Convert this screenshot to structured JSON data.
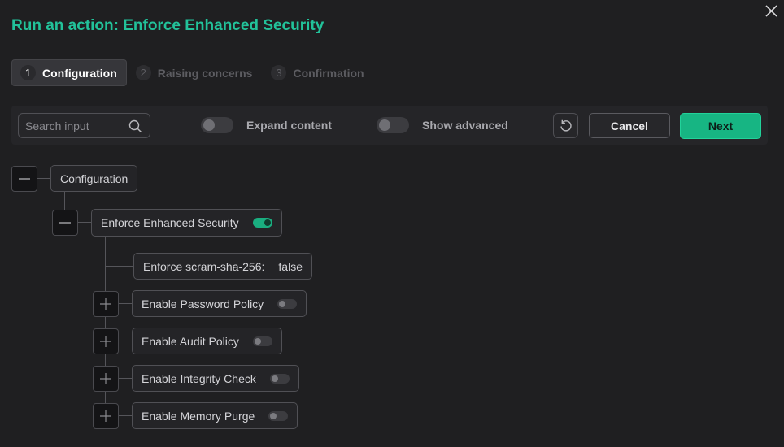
{
  "dialog": {
    "title": "Run an action: Enforce Enhanced Security"
  },
  "steps": [
    {
      "number": "1",
      "label": "Configuration",
      "active": true
    },
    {
      "number": "2",
      "label": "Raising concerns",
      "active": false
    },
    {
      "number": "3",
      "label": "Confirmation",
      "active": false
    }
  ],
  "toolbar": {
    "search_placeholder": "Search input",
    "expand_content_label": "Expand content",
    "expand_content_on": false,
    "show_advanced_label": "Show advanced",
    "show_advanced_on": false,
    "cancel_label": "Cancel",
    "next_label": "Next"
  },
  "tree": {
    "root": {
      "label": "Configuration",
      "expanded": true
    },
    "action": {
      "label": "Enforce Enhanced Security",
      "enabled": true,
      "expanded": true
    },
    "param": {
      "label": "Enforce scram-sha-256:",
      "value": "false"
    },
    "children": [
      {
        "label": "Enable Password Policy",
        "enabled": false
      },
      {
        "label": "Enable Audit Policy",
        "enabled": false
      },
      {
        "label": "Enable Integrity Check",
        "enabled": false
      },
      {
        "label": "Enable Memory Purge",
        "enabled": false
      }
    ]
  },
  "colors": {
    "accent": "#22c29a",
    "primary_button": "#17b583",
    "background": "#1f1f21"
  }
}
